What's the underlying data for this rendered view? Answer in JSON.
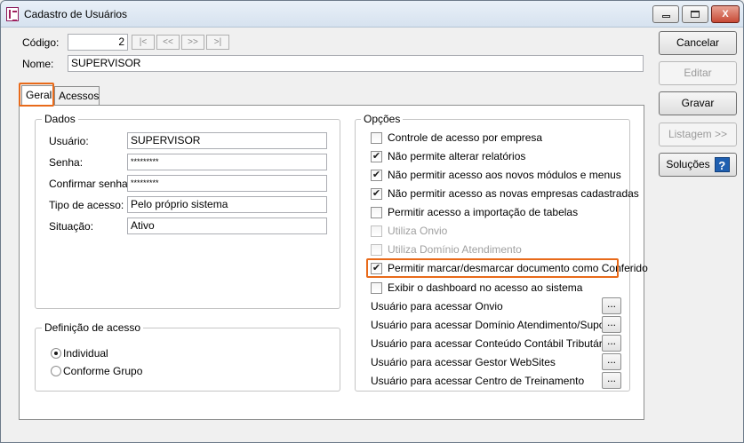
{
  "window": {
    "title": "Cadastro de Usuários",
    "controls": {
      "minimize": "",
      "maximize": "",
      "close": "X"
    }
  },
  "header": {
    "codigo_label": "Código:",
    "codigo_value": "2",
    "nav": [
      "|<",
      "<<",
      ">>",
      ">|"
    ],
    "nome_label": "Nome:",
    "nome_value": "SUPERVISOR"
  },
  "tabs": [
    {
      "label": "Geral",
      "active": true
    },
    {
      "label": "Acessos",
      "active": false
    }
  ],
  "dados": {
    "title": "Dados",
    "fields": [
      {
        "label": "Usuário:",
        "value": "SUPERVISOR"
      },
      {
        "label": "Senha:",
        "value": "*********"
      },
      {
        "label": "Confirmar senha:",
        "value": "*********"
      },
      {
        "label": "Tipo de acesso:",
        "value": "Pelo próprio sistema"
      },
      {
        "label": "Situação:",
        "value": "Ativo"
      }
    ]
  },
  "definicao": {
    "title": "Definição de acesso",
    "options": [
      {
        "label": "Individual",
        "selected": true
      },
      {
        "label": "Conforme Grupo",
        "selected": false
      }
    ]
  },
  "opcoes": {
    "title": "Opções",
    "checks": [
      {
        "label": "Controle de acesso por empresa",
        "checked": false,
        "enabled": true
      },
      {
        "label": "Não permite alterar relatórios",
        "checked": true,
        "enabled": true
      },
      {
        "label": "Não permitir acesso aos novos módulos e menus",
        "checked": true,
        "enabled": true
      },
      {
        "label": "Não permitir acesso as novas empresas cadastradas",
        "checked": true,
        "enabled": true
      },
      {
        "label": "Permitir acesso a importação de tabelas",
        "checked": false,
        "enabled": true
      },
      {
        "label": "Utiliza Onvio",
        "checked": false,
        "enabled": false
      },
      {
        "label": "Utiliza Domínio Atendimento",
        "checked": false,
        "enabled": false
      },
      {
        "label": "Permitir marcar/desmarcar documento como Conferido",
        "checked": true,
        "enabled": true
      },
      {
        "label": "Exibir o dashboard no acesso ao sistema",
        "checked": false,
        "enabled": true
      }
    ],
    "user_access": [
      {
        "label": "Usuário para acessar Onvio",
        "button": "..."
      },
      {
        "label": "Usuário para acessar Domínio Atendimento/Suporte",
        "button": "..."
      },
      {
        "label": "Usuário para acessar Conteúdo Contábil Tributário",
        "button": "..."
      },
      {
        "label": "Usuário para acessar Gestor WebSites",
        "button": "..."
      },
      {
        "label": "Usuário para acessar Centro de Treinamento",
        "button": "..."
      }
    ]
  },
  "side_buttons": [
    {
      "label": "Cancelar",
      "enabled": true
    },
    {
      "label": "Editar",
      "enabled": false
    },
    {
      "label": "Gravar",
      "enabled": true
    },
    {
      "label": "Listagem >>",
      "enabled": false
    },
    {
      "label": "Soluções",
      "enabled": true,
      "icon": "help-icon",
      "icon_glyph": "?"
    }
  ],
  "colors": {
    "highlight": "#e86a1a",
    "help_icon": "#1f5fb0"
  }
}
